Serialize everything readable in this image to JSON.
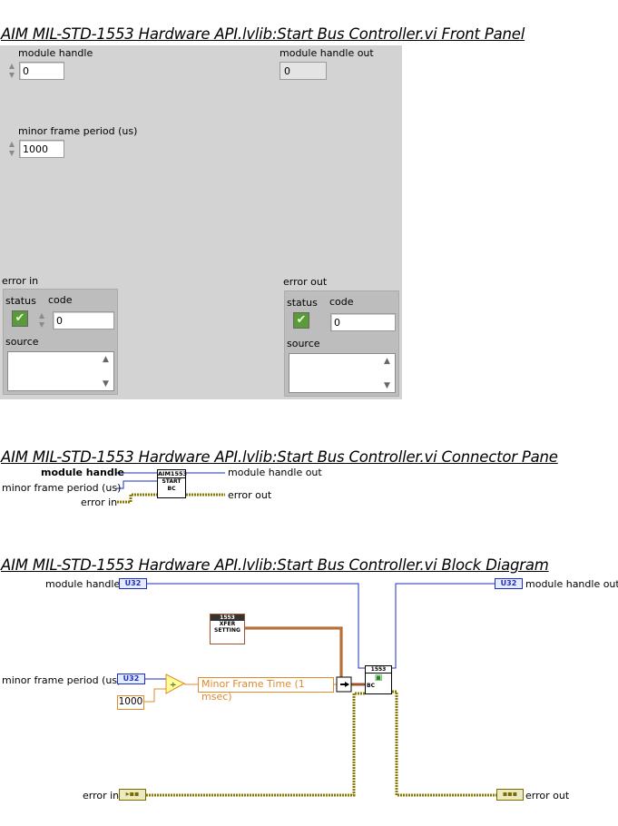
{
  "front_panel": {
    "title": "AIM MIL-STD-1553 Hardware API.lvlib:Start Bus Controller.vi Front Panel",
    "module_handle": {
      "label": "module handle",
      "value": "0"
    },
    "module_handle_out": {
      "label": "module handle out",
      "value": "0"
    },
    "minor_frame_period": {
      "label": "minor frame period (us)",
      "value": "1000"
    },
    "error_in": {
      "label": "error in",
      "status_label": "status",
      "code_label": "code",
      "code_value": "0",
      "source_label": "source",
      "source_value": ""
    },
    "error_out": {
      "label": "error out",
      "status_label": "status",
      "code_label": "code",
      "code_value": "0",
      "source_label": "source",
      "source_value": ""
    }
  },
  "connector_pane": {
    "title": "AIM MIL-STD-1553 Hardware API.lvlib:Start Bus Controller.vi Connector Pane",
    "inputs": [
      "module handle",
      "minor frame period (us)",
      "error in"
    ],
    "outputs": [
      "module handle out",
      "error out"
    ],
    "icon": {
      "header": "AIM1553",
      "line1": "START",
      "line2": "BC"
    }
  },
  "block_diagram": {
    "title": "AIM MIL-STD-1553 Hardware API.lvlib:Start Bus Controller.vi Block Diagram",
    "module_handle_label": "module handle",
    "module_handle_out_label": "module handle out",
    "minor_frame_label": "minor frame period (us)",
    "error_in_label": "error in",
    "error_out_label": "error out",
    "type_u32": "U32",
    "const_1000": "1000",
    "enum_text": "Minor Frame Time (1 msec)",
    "xfer_vi": {
      "header": "1553",
      "line1": "XFER",
      "line2": "SETTING"
    },
    "start_vi": {
      "header": "1553",
      "line1": "BC"
    },
    "colors": {
      "wire_blue": "#1a2fbf",
      "wire_orange": "#e08a2a",
      "wire_error": "#8a7a00",
      "wire_cluster": "#a0522d"
    }
  }
}
